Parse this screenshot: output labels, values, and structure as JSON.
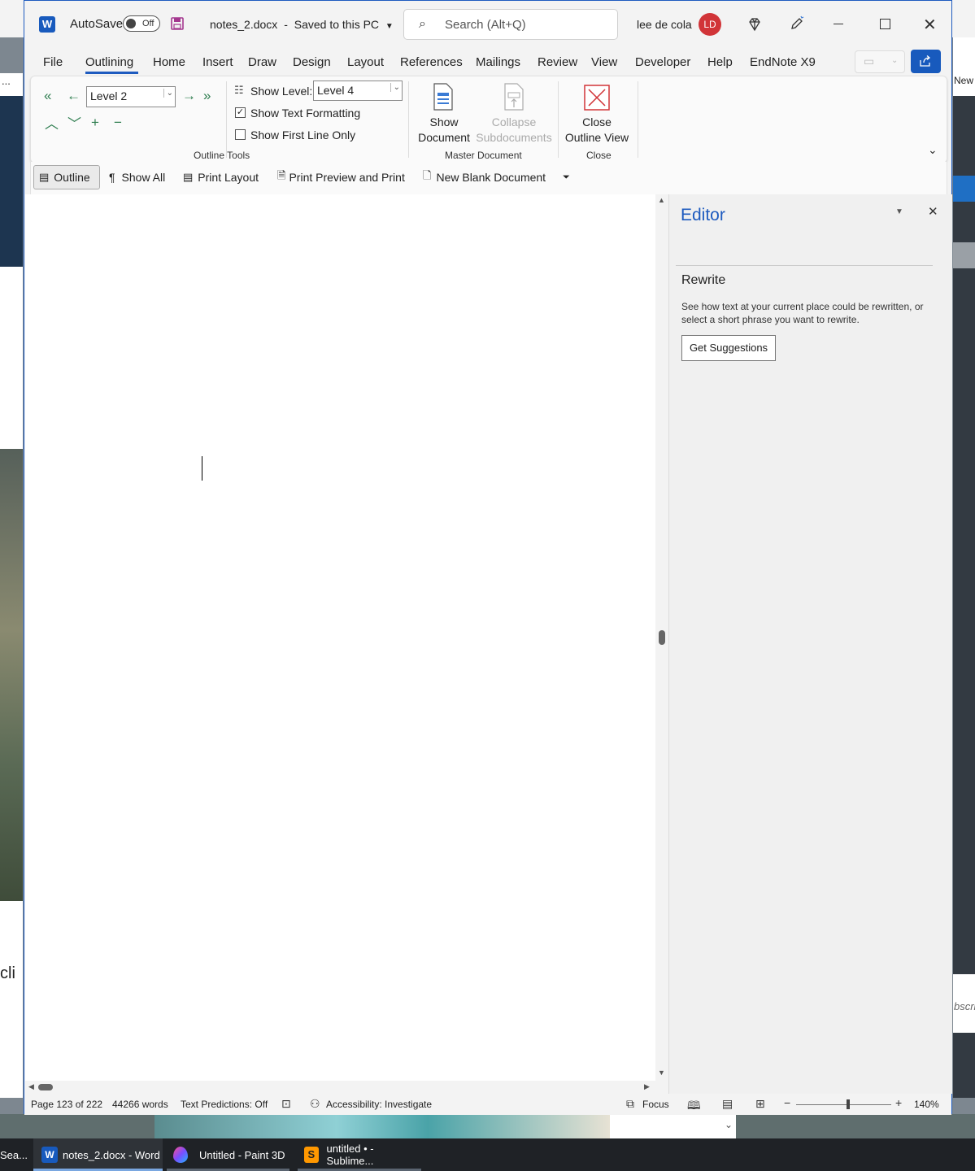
{
  "window": {
    "app_icon": "word-icon",
    "autosave_label": "AutoSave",
    "autosave_state": "Off",
    "doc_title": "notes_2.docx",
    "title_sep": "-",
    "save_status": "Saved to this PC",
    "search_placeholder": "Search (Alt+Q)",
    "user_name": "lee de cola",
    "user_initials": "LD"
  },
  "menu": [
    "File",
    "Outlining",
    "Home",
    "Insert",
    "Draw",
    "Design",
    "Layout",
    "References",
    "Mailings",
    "Review",
    "View",
    "Developer",
    "Help",
    "EndNote X9"
  ],
  "menu_active": "Outlining",
  "ribbon": {
    "level_value": "Level 2",
    "show_level_label": "Show Level:",
    "show_level_value": "Level 4",
    "show_text_formatting": "Show Text Formatting",
    "show_first_line_only": "Show First Line Only",
    "outline_tools_label": "Outline Tools",
    "show_document_l1": "Show",
    "show_document_l2": "Document",
    "collapse_l1": "Collapse",
    "collapse_l2": "Subdocuments",
    "master_document_label": "Master Document",
    "close_l1": "Close",
    "close_l2": "Outline View",
    "close_group_label": "Close"
  },
  "views": {
    "outline": "Outline",
    "show_all": "Show All",
    "print_layout": "Print Layout",
    "print_preview": "Print Preview and Print",
    "new_blank": "New Blank Document"
  },
  "editor": {
    "title": "Editor",
    "rewrite_heading": "Rewrite",
    "rewrite_desc": "See how text at your current place could be rewritten, or select a short phrase you want to rewrite.",
    "get_suggestions": "Get Suggestions"
  },
  "status": {
    "page": "Page 123 of 222",
    "words": "44266 words",
    "text_predictions": "Text Predictions: Off",
    "accessibility": "Accessibility: Investigate",
    "focus": "Focus",
    "zoom": "140%"
  },
  "taskbar": {
    "search": "Sea...",
    "word": "notes_2.docx - Word",
    "paint": "Untitled - Paint 3D",
    "sublime": "untitled • - Sublime..."
  },
  "background": {
    "left_text": "cli",
    "right_text_top": "New",
    "right_text_bottom": "bscri",
    "left_ellipsis": "..."
  },
  "colors": {
    "accent": "#1e5bbf",
    "avatar": "#d13438",
    "outline_green": "#2e7d4f",
    "close_red": "#d13438"
  }
}
